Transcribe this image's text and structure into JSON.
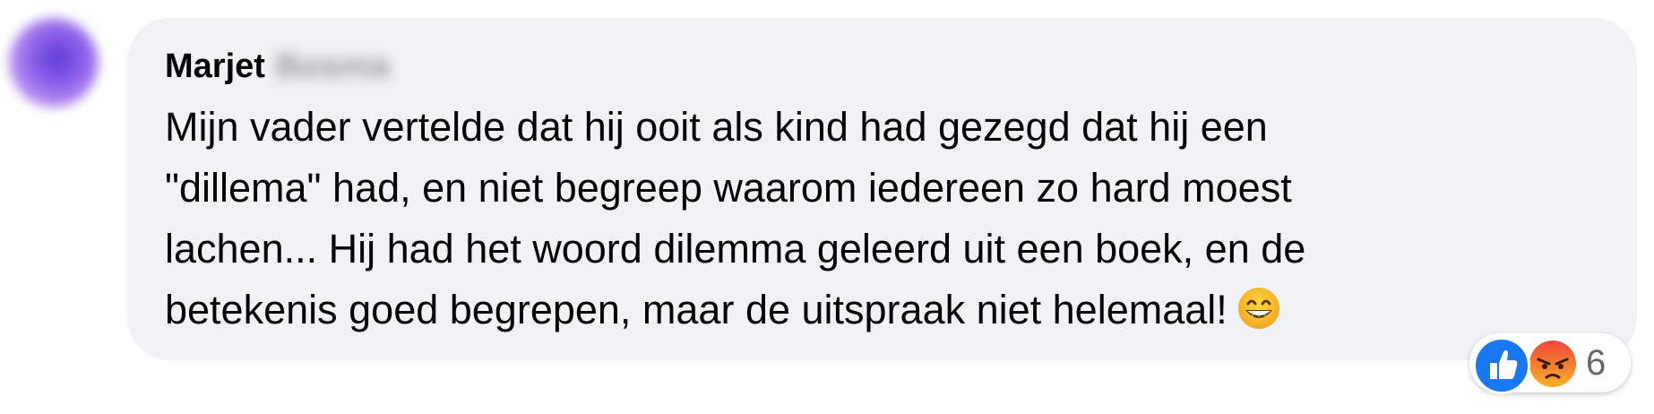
{
  "author": {
    "name": "Marjet",
    "surname_redacted": "Bosma"
  },
  "comment": {
    "lines": [
      "Mijn vader vertelde dat hij ooit als kind had gezegd dat hij een",
      "\"dillema\" had, en niet begreep waarom iedereen zo hard moest",
      "lachen... Hij had het woord dilemma geleerd uit een boek, en de",
      "betekenis goed begrepen, maar de uitspraak niet helemaal!"
    ],
    "trailing_emoji": "grinning-face-icon"
  },
  "reactions": {
    "icons": [
      "like-icon",
      "angry-icon"
    ],
    "count": "6"
  },
  "colors": {
    "bubble": "#f0f2f5",
    "like_blue": "#1877f2",
    "text": "#050505",
    "muted": "#65676b"
  }
}
